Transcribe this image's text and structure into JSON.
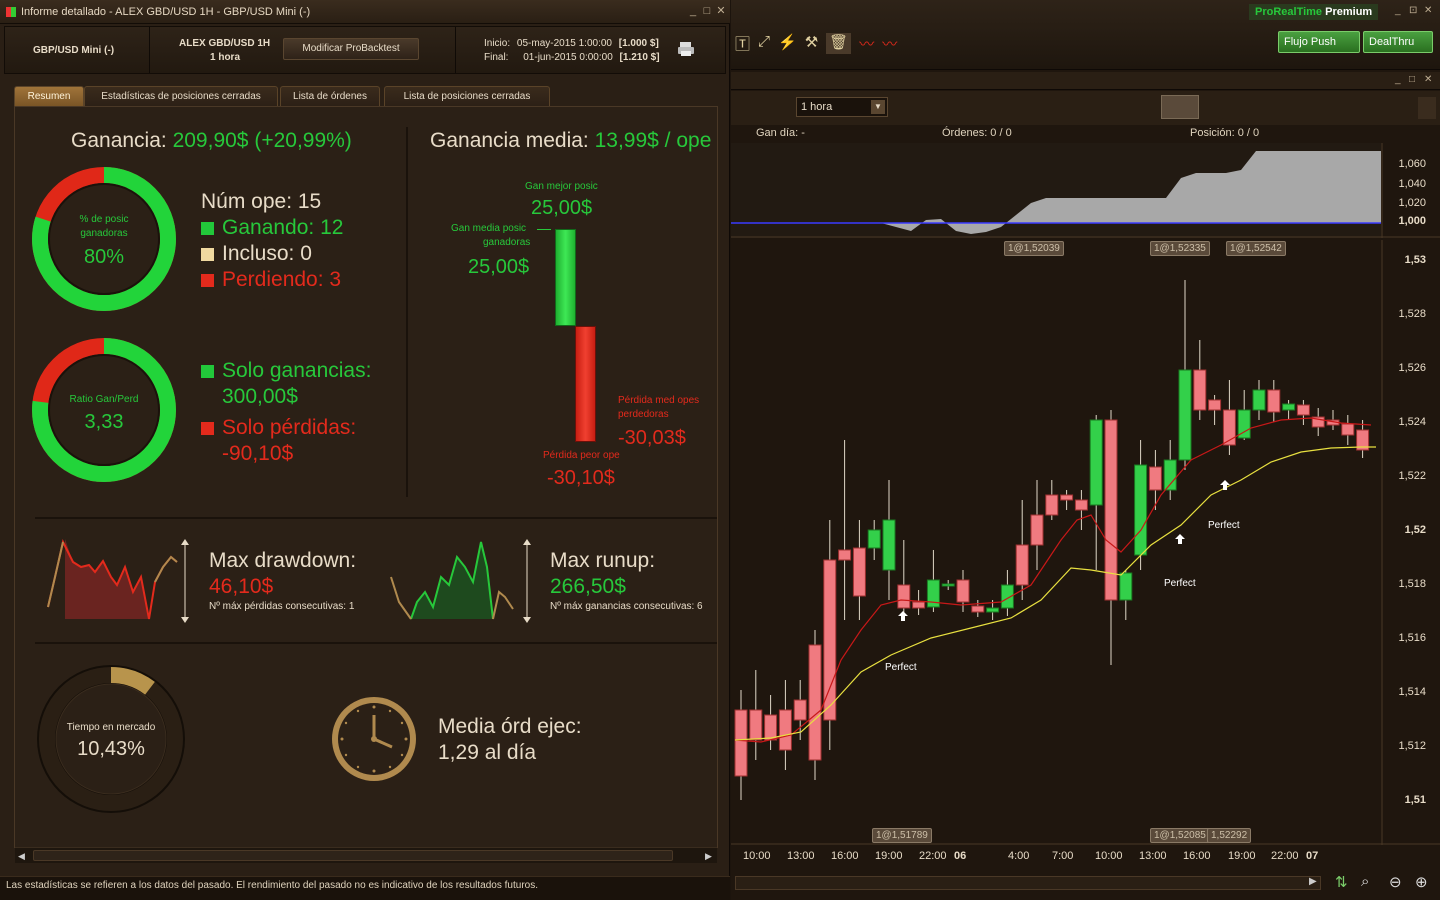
{
  "left_window": {
    "title": "Informe detallado - ALEX  GBD/USD 1H - GBP/USD Mini (-)",
    "instrument": "GBP/USD Mini (-)",
    "system_name": "ALEX  GBD/USD 1H",
    "timeframe": "1 hora",
    "modify_button": "Modificar ProBacktest",
    "start_label": "Inicio:",
    "start_value": "05-may-2015 1:00:00",
    "start_capital": "[1.000 $]",
    "end_label": "Final:",
    "end_value": "01-jun-2015 0:00:00",
    "end_capital": "[1.210 $]",
    "tabs": [
      "Resumen",
      "Estadísticas de posiciones cerradas",
      "Lista de órdenes",
      "Lista de posiciones cerradas"
    ],
    "gain_label": "Ganancia:",
    "gain_value": "209,90$ (+20,99%)",
    "donut1_label1": "% de posic",
    "donut1_label2": "ganadoras",
    "donut1_value": "80%",
    "donut1_pct": 80,
    "num_ope": "Núm ope: 15",
    "winning": "Ganando: 12",
    "even": "Incluso: 0",
    "losing": "Perdiendo: 3",
    "donut2_label": "Ratio Gan/Perd",
    "donut2_value": "3,33",
    "donut2_pct": 77,
    "only_gains_label": "Solo ganancias:",
    "only_gains_value": "300,00$",
    "only_losses_label": "Solo pérdidas:",
    "only_losses_value": "-90,10$",
    "avg_gain_label": "Ganancia media:",
    "avg_gain_value": "13,99$ / ope",
    "best_label": "Gan mejor posic",
    "best_value": "25,00$",
    "avg_win_label1": "Gan media posic",
    "avg_win_label2": "ganadoras",
    "avg_win_value": "25,00$",
    "avg_loss_label1": "Pérdida med opes",
    "avg_loss_label2": "perdedoras",
    "avg_loss_value": "-30,03$",
    "worst_label": "Pérdida peor ope",
    "worst_value": "-30,10$",
    "drawdown_label": "Max drawdown:",
    "drawdown_value": "46,10$",
    "drawdown_consec": "Nº máx pérdidas consecutivas: 1",
    "runup_label": "Max runup:",
    "runup_value": "266,50$",
    "runup_consec": "Nº máx ganancias consecutivas: 6",
    "market_time_label": "Tiempo en mercado",
    "market_time_value": "10,43%",
    "market_time_pct": 10.43,
    "avg_orders_label": "Media órd ejec:",
    "avg_orders_value": "1,29 al día",
    "status": "Las estadísticas se refieren a los datos del pasado. El rendimiento del pasado no es indicativo de los resultados futuros."
  },
  "right_window": {
    "brand_pre": "ProRealTime",
    "brand_post": "Premium",
    "flujo_button": "Flujo Push",
    "dealthru_button": "DealThru",
    "timeframe_select": "1 hora",
    "gan_dia": "Gan día:  -",
    "ordenes": "Órdenes:  0",
    "ordenes2": "/  0",
    "posicion": "Posición:  0",
    "posicion2": "/  0",
    "equity_ticks": [
      "1,060",
      "1,040",
      "1,020",
      "1,000"
    ],
    "price_ticks": [
      "1,53",
      "1,528",
      "1,526",
      "1,524",
      "1,522",
      "1,52",
      "1,518",
      "1,516",
      "1,514",
      "1,512",
      "1,51"
    ],
    "time_ticks": [
      "10:00",
      "13:00",
      "16:00",
      "19:00",
      "22:00",
      "06",
      "4:00",
      "7:00",
      "10:00",
      "13:00",
      "16:00",
      "19:00",
      "22:00",
      "07"
    ],
    "top_labels": [
      "1@1,52039",
      "1@1,52335",
      "1@1,52542"
    ],
    "bottom_labels": [
      "1@1,51789",
      "1@1,52085",
      "1,52292"
    ],
    "annotations": [
      "Perfect",
      "Perfect",
      "Perfect"
    ]
  },
  "colors": {
    "green": "#27c83b",
    "red": "#e32a1c",
    "gold": "#b08a4e",
    "bg": "#2b2016"
  }
}
